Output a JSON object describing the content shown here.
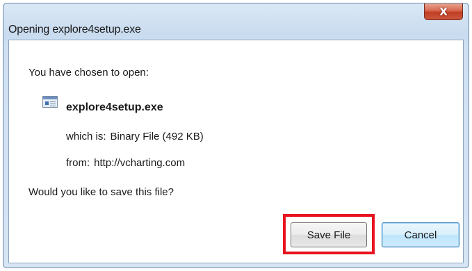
{
  "dialog": {
    "title": "Opening explore4setup.exe",
    "close_label": "X"
  },
  "content": {
    "intro": "You have chosen to open:",
    "file_icon": "executable-file-icon",
    "filename": "explore4setup.exe",
    "type_label": "which is:",
    "type_value": "Binary File (492 KB)",
    "from_label": "from:",
    "from_value": "http://vcharting.com",
    "question": "Would you like to save this file?"
  },
  "buttons": {
    "save_label": "Save File",
    "cancel_label": "Cancel"
  },
  "highlight": {
    "target": "save-file-button",
    "color": "#e8131f"
  }
}
